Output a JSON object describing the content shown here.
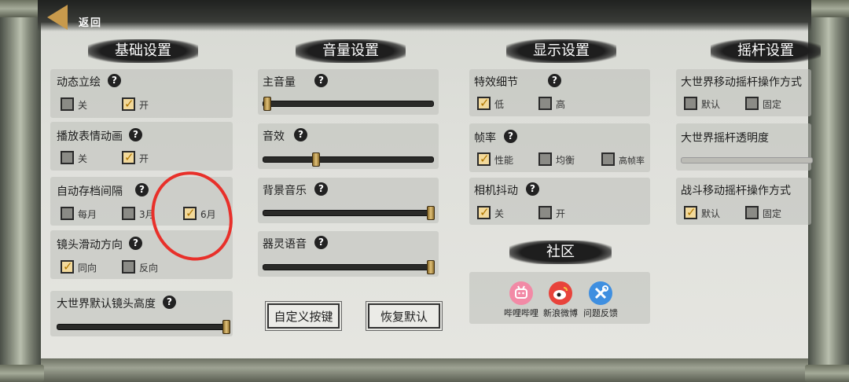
{
  "header": {
    "back_label": "返回"
  },
  "sections": {
    "basic": {
      "title": "基础设置",
      "dynamic_portrait": {
        "label": "动态立绘",
        "options": [
          "关",
          "开"
        ],
        "selected": "开"
      },
      "emote_anim": {
        "label": "播放表情动画",
        "options": [
          "关",
          "开"
        ],
        "selected": "开"
      },
      "autosave": {
        "label": "自动存档间隔",
        "options": [
          "每月",
          "3月",
          "6月"
        ],
        "selected": "6月"
      },
      "camera_dir": {
        "label": "镜头滑动方向",
        "options": [
          "同向",
          "反向"
        ],
        "selected": "同向"
      },
      "camera_height": {
        "label": "大世界默认镜头高度",
        "level": 1.0
      }
    },
    "volume": {
      "title": "音量设置",
      "master": {
        "label": "主音量",
        "level": 0.0
      },
      "sfx": {
        "label": "音效",
        "level": 0.3
      },
      "bgm": {
        "label": "背景音乐",
        "level": 1.0
      },
      "voice": {
        "label": "器灵语音",
        "level": 1.0
      },
      "custom_keys_label": "自定义按键",
      "restore_label": "恢复默认"
    },
    "display": {
      "title": "显示设置",
      "effects": {
        "label": "特效细节",
        "options": [
          "低",
          "高"
        ],
        "selected": "低"
      },
      "framerate": {
        "label": "帧率",
        "options": [
          "性能",
          "均衡",
          "高帧率"
        ],
        "selected": "性能"
      },
      "camera_shake": {
        "label": "相机抖动",
        "options": [
          "关",
          "开"
        ],
        "selected": "关"
      }
    },
    "joystick": {
      "title": "摇杆设置",
      "world_move": {
        "label": "大世界移动摇杆操作方式",
        "options": [
          "默认",
          "固定"
        ],
        "selected": ""
      },
      "world_alpha": {
        "label": "大世界摇杆透明度"
      },
      "battle_move": {
        "label": "战斗移动摇杆操作方式",
        "options": [
          "默认",
          "固定"
        ],
        "selected": "默认"
      }
    },
    "community": {
      "title": "社区",
      "links": [
        {
          "label": "哔哩哔哩",
          "icon": "bilibili-icon",
          "color": "#f28aa6"
        },
        {
          "label": "新浪微博",
          "icon": "weibo-icon",
          "color": "#e8433b"
        },
        {
          "label": "问题反馈",
          "icon": "wrench-icon",
          "color": "#3f8fe0"
        }
      ]
    }
  },
  "colors": {
    "accent_gold": "#c89a4c",
    "annotation_red": "#e8302a",
    "checked_fill": "#f2d99b"
  }
}
